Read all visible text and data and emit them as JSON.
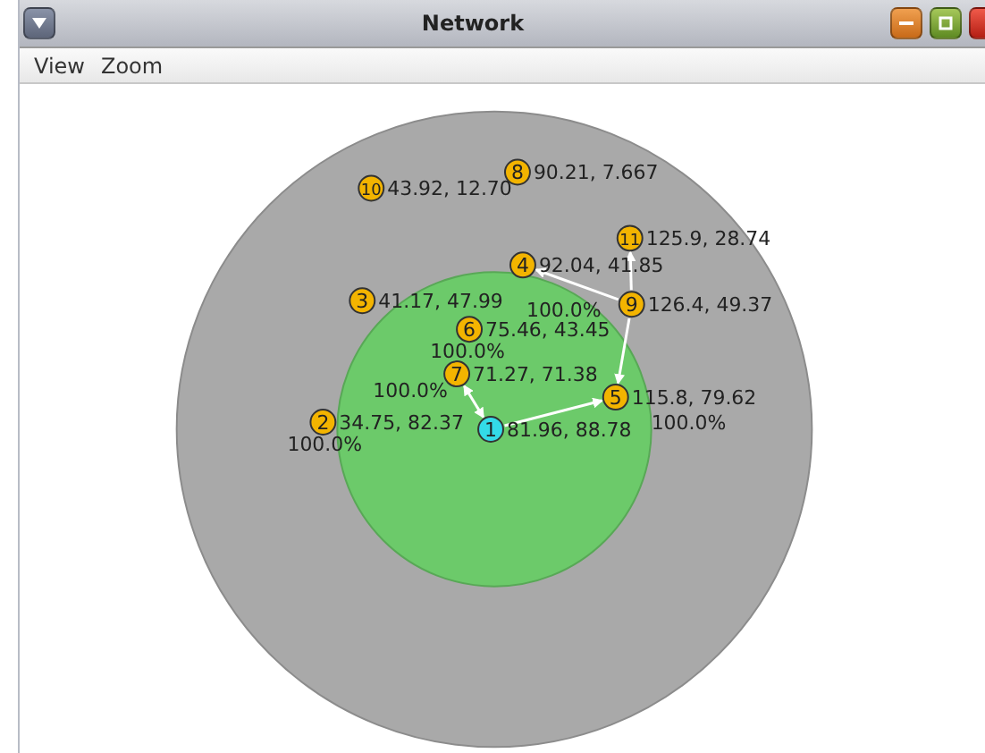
{
  "window": {
    "title": "Network"
  },
  "menu": [
    "View",
    "Zoom"
  ],
  "network": {
    "rings": [
      {
        "kind": "range"
      },
      {
        "kind": "core"
      }
    ],
    "nodes": [
      {
        "number": "8",
        "kind": "node",
        "coords": "90.21, 7.667"
      },
      {
        "number": "10",
        "kind": "node",
        "coords": "43.92, 12.70"
      },
      {
        "number": "11",
        "kind": "node",
        "coords": "125.9, 28.74"
      },
      {
        "number": "3",
        "kind": "node",
        "coords": "41.17, 47.99"
      },
      {
        "number": "4",
        "kind": "node",
        "coords": "92.04, 41.85",
        "percent": "100.0%"
      },
      {
        "number": "9",
        "kind": "node",
        "coords": "126.4, 49.37"
      },
      {
        "number": "6",
        "kind": "node",
        "coords": "75.46, 43.45",
        "percent": "100.0%"
      },
      {
        "number": "7",
        "kind": "node",
        "coords": "71.27, 71.38",
        "percent": "100.0%"
      },
      {
        "number": "5",
        "kind": "node",
        "coords": "115.8, 79.62",
        "percent": "100.0%"
      },
      {
        "number": "2",
        "kind": "node",
        "coords": "34.75, 82.37",
        "percent": "100.0%"
      },
      {
        "number": "1",
        "kind": "base",
        "coords": "81.96, 88.78"
      }
    ],
    "links": [
      {
        "two_way": true
      },
      {
        "two_way": false
      },
      {
        "two_way": false
      },
      {
        "two_way": false
      },
      {
        "two_way": false
      }
    ]
  }
}
